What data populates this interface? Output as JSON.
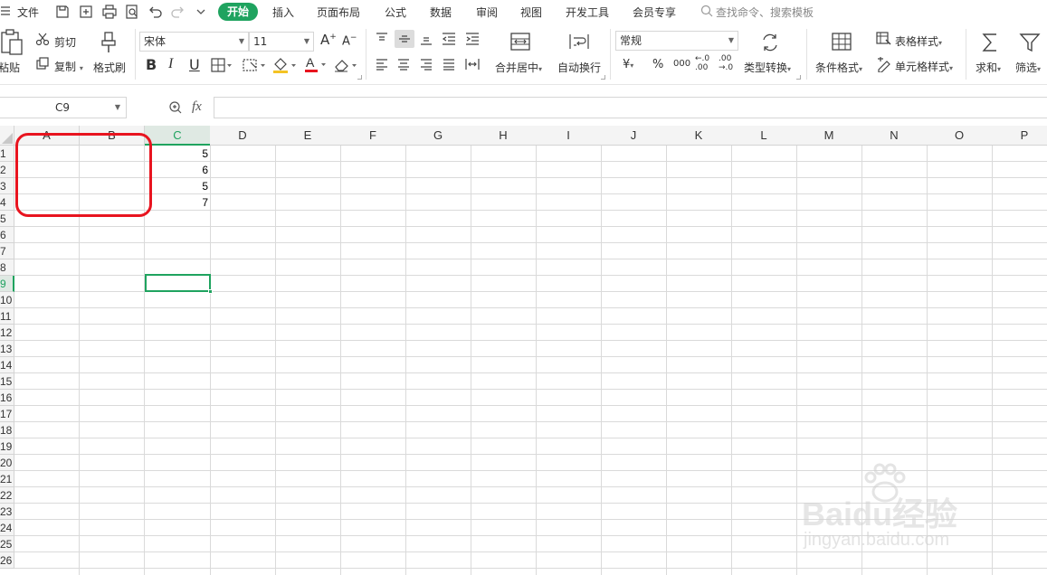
{
  "menu": {
    "file_label": "文件",
    "tabs": [
      "开始",
      "插入",
      "页面布局",
      "公式",
      "数据",
      "审阅",
      "视图",
      "开发工具",
      "会员专享"
    ],
    "search_placeholder": "查找命令、搜索模板"
  },
  "ribbon": {
    "paste_label": "粘贴",
    "cut_label": "剪切",
    "copy_label": "复制",
    "format_painter_label": "格式刷",
    "font_name": "宋体",
    "font_size": "11",
    "bold": "B",
    "italic": "I",
    "underline": "U",
    "merge_center_label": "合并居中",
    "wrap_text_label": "自动换行",
    "number_format": "常规",
    "currency_symbol": "¥",
    "percent_symbol": "%",
    "thousands_label": "000",
    "decimal_increase_label": "←.0 .00",
    "decimal_decrease_label": ".00 →.0",
    "type_convert_label": "类型转换",
    "conditional_format_label": "条件格式",
    "table_style_label": "表格样式",
    "cell_style_label": "单元格样式",
    "sum_label": "求和",
    "filter_label": "筛选"
  },
  "formula_bar": {
    "name_box": "C9",
    "fx_label": "fx",
    "formula": ""
  },
  "sheet": {
    "columns": [
      "A",
      "B",
      "C",
      "D",
      "E",
      "F",
      "G",
      "H",
      "I",
      "J",
      "K",
      "L",
      "M",
      "N",
      "O",
      "P"
    ],
    "rows": [
      "1",
      "2",
      "3",
      "4",
      "5",
      "6",
      "7",
      "8",
      "9",
      "10",
      "11",
      "12",
      "13",
      "14",
      "15",
      "16",
      "17",
      "18",
      "19",
      "20",
      "21",
      "22",
      "23",
      "24",
      "25",
      "26"
    ],
    "selected_column": "C",
    "selected_row": "9",
    "cells": [
      {
        "ref": "C1",
        "value": "5"
      },
      {
        "ref": "C2",
        "value": "6"
      },
      {
        "ref": "C3",
        "value": "5"
      },
      {
        "ref": "C4",
        "value": "7"
      }
    ]
  },
  "annotation": {
    "color": "#e8141f"
  },
  "colors": {
    "accent": "#1fa35f",
    "grid_line": "#dadada"
  },
  "watermark": {
    "brand": "Baidu经验",
    "url": "jingyan.baidu.com"
  }
}
